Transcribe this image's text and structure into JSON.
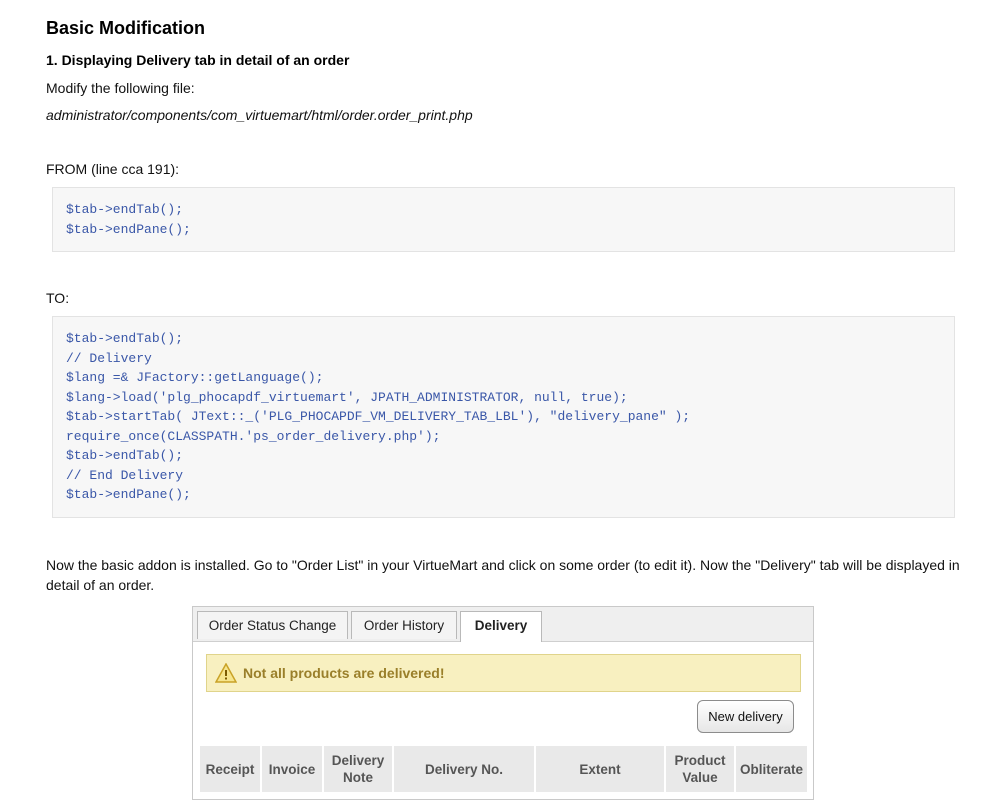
{
  "heading": "Basic Modification",
  "subheading": "1. Displaying Delivery tab in detail of an order",
  "modify_text": "Modify the following file:",
  "file_path": "administrator/components/com_virtuemart/html/order.order_print.php",
  "from_label": "FROM (line cca 191):",
  "from_code": [
    "$tab->endTab();",
    "$tab->endPane();"
  ],
  "to_label": "TO:",
  "to_code": [
    "$tab->endTab();",
    "// Delivery",
    "$lang =& JFactory::getLanguage();",
    "$lang->load('plg_phocapdf_virtuemart', JPATH_ADMINISTRATOR, null, true);",
    "$tab->startTab( JText::_('PLG_PHOCAPDF_VM_DELIVERY_TAB_LBL'), \"delivery_pane\" );",
    "require_once(CLASSPATH.'ps_order_delivery.php');",
    "$tab->endTab();",
    "// End Delivery",
    "$tab->endPane();"
  ],
  "now_text": "Now the basic addon is installed. Go to \"Order List\" in your VirtueMart and click on some order (to edit it). Now the \"Delivery\" tab will be displayed in detail of an order.",
  "screenshot": {
    "tabs": [
      "Order Status Change",
      "Order History",
      "Delivery"
    ],
    "active_tab": "Delivery",
    "alert_icon": "warning-icon",
    "alert_text": "Not all products are delivered!",
    "new_delivery_label": "New delivery",
    "columns": [
      "Receipt",
      "Invoice",
      "Delivery Note",
      "Delivery No.",
      "Extent",
      "Product Value",
      "Obliterate"
    ]
  }
}
